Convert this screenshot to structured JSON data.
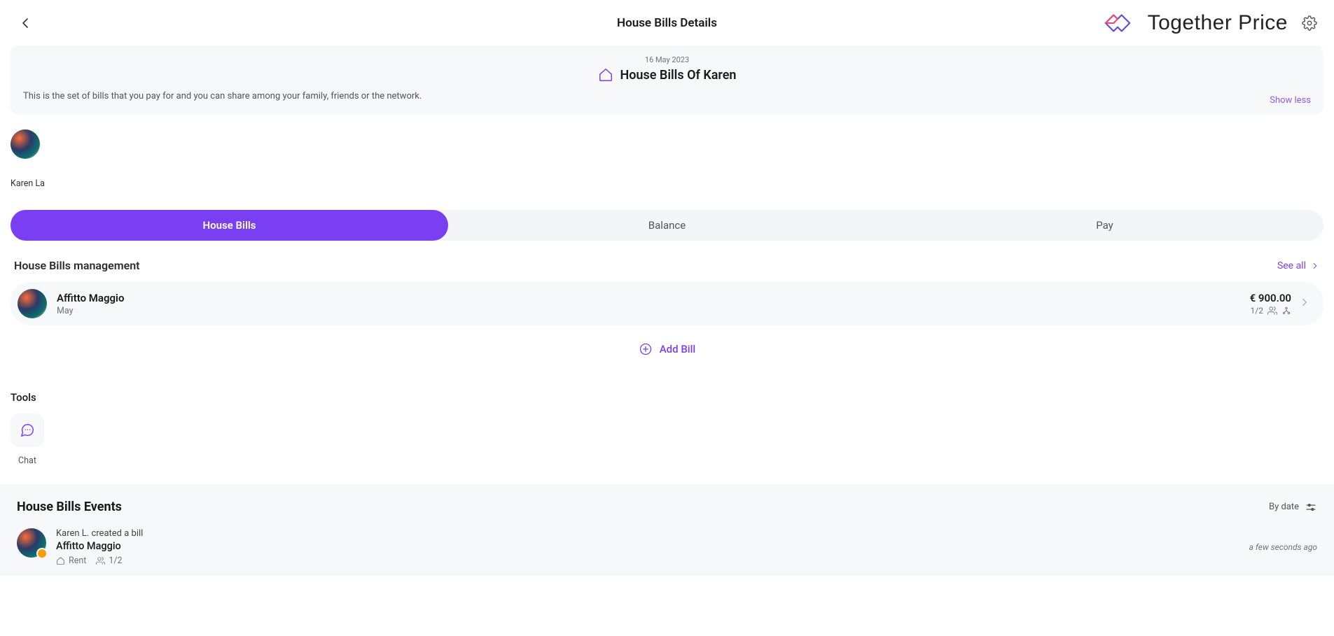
{
  "header": {
    "title": "House Bills Details",
    "brand": "Together Price"
  },
  "info": {
    "date": "16 May 2023",
    "title": "House Bills Of Karen",
    "description": "This is the set of bills that you pay for and you can share among your family, friends or the network.",
    "toggle": "Show less"
  },
  "owner": {
    "name": "Karen La"
  },
  "tabs": {
    "items": [
      "House Bills",
      "Balance",
      "Pay"
    ],
    "active": 0
  },
  "management": {
    "heading": "House Bills management",
    "see_all": "See all"
  },
  "bills": [
    {
      "title": "Affitto Maggio",
      "subtitle": "May",
      "amount": "€ 900.00",
      "participants": "1/2"
    }
  ],
  "add_bill": "Add Bill",
  "tools": {
    "heading": "Tools",
    "items": [
      {
        "label": "Chat"
      }
    ]
  },
  "events": {
    "heading": "House Bills Events",
    "sort": "By date",
    "items": [
      {
        "line1": "Karen L. created a bill",
        "line2": "Affitto Maggio",
        "category": "Rent",
        "participants": "1/2",
        "time": "a few seconds ago"
      }
    ]
  }
}
